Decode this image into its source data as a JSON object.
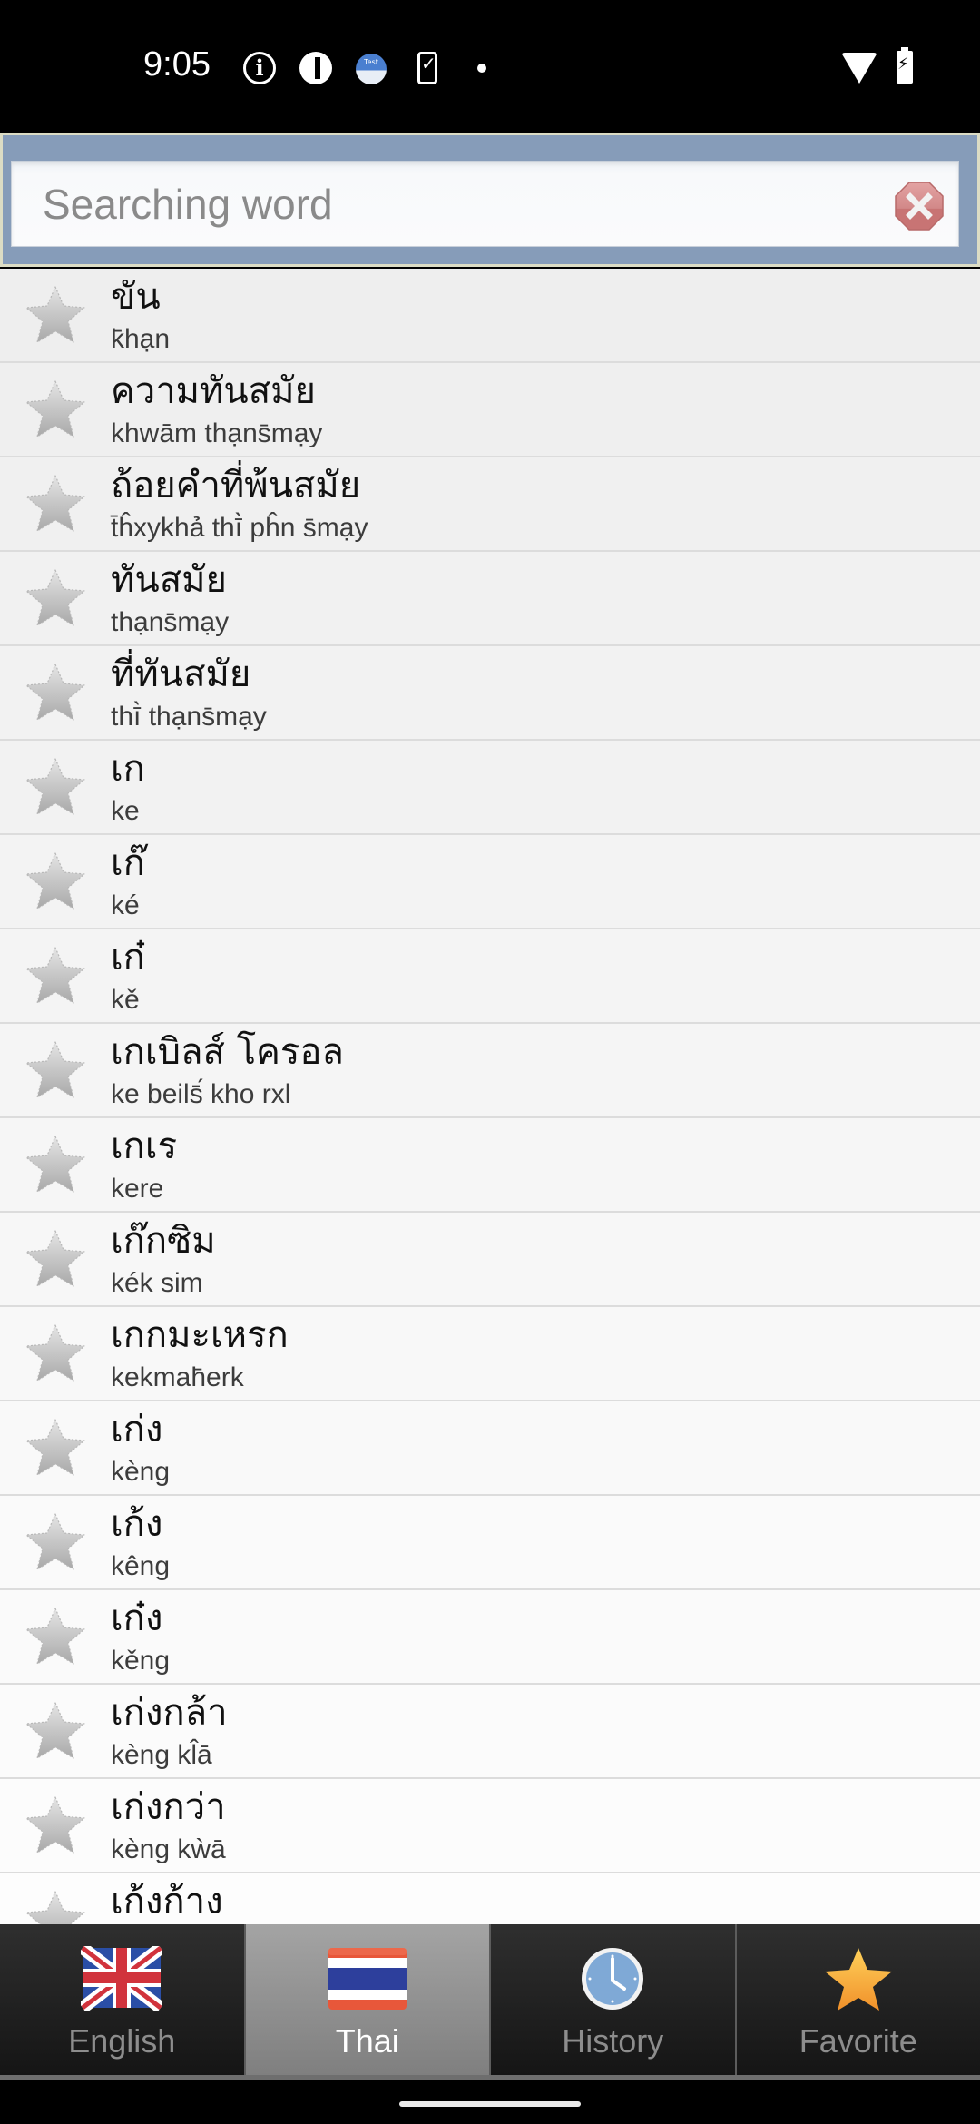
{
  "status_bar": {
    "time": "9:05",
    "icons": [
      "info-icon",
      "app-pill-icon",
      "test-app-icon",
      "phone-check-icon",
      "notification-dot-icon",
      "wifi-icon",
      "battery-charging-icon"
    ],
    "test_icon_label": "Test"
  },
  "search": {
    "placeholder": "Searching word",
    "value": "",
    "clear_icon": "clear-icon",
    "clear_color": "#c97878"
  },
  "words": [
    {
      "thai": "ขัน",
      "roman": "k̄hạn",
      "favorite": false
    },
    {
      "thai": "ความทันสมัย",
      "roman": "khwām thạns̄mạy",
      "favorite": false
    },
    {
      "thai": "ถ้อยคำที่พ้นสมัย",
      "roman": "t̄ĥxykhả thī̀ pĥn s̄mạy",
      "favorite": false
    },
    {
      "thai": "ทันสมัย",
      "roman": "thạns̄mạy",
      "favorite": false
    },
    {
      "thai": "ที่ทันสมัย",
      "roman": "thī̀ thạns̄mạy",
      "favorite": false
    },
    {
      "thai": "เก",
      "roman": "ke",
      "favorite": false
    },
    {
      "thai": "เก๊",
      "roman": "ké",
      "favorite": false
    },
    {
      "thai": "เก๋",
      "roman": "kě",
      "favorite": false
    },
    {
      "thai": "เกเบิลส์ โครอล",
      "roman": "ke beils̄́ kho rxl",
      "favorite": false
    },
    {
      "thai": "เกเร",
      "roman": "kere",
      "favorite": false
    },
    {
      "thai": "เก๊กซิม",
      "roman": "kék sim",
      "favorite": false
    },
    {
      "thai": "เกกมะเหรก",
      "roman": "kekmah̄erk",
      "favorite": false
    },
    {
      "thai": "เก่ง",
      "roman": "kèng",
      "favorite": false
    },
    {
      "thai": "เก้ง",
      "roman": "kêng",
      "favorite": false
    },
    {
      "thai": "เก๋ง",
      "roman": "kěng",
      "favorite": false
    },
    {
      "thai": "เก่งกล้า",
      "roman": "kèng kl̂ā",
      "favorite": false
    },
    {
      "thai": "เก่งกว่า",
      "roman": "kèng kẁā",
      "favorite": false
    },
    {
      "thai": "เก้งก้าง",
      "roman": "",
      "favorite": false
    }
  ],
  "tabs": [
    {
      "label": "English",
      "icon": "uk-flag-icon",
      "selected": false
    },
    {
      "label": "Thai",
      "icon": "thai-flag-icon",
      "selected": true
    },
    {
      "label": "History",
      "icon": "clock-icon",
      "selected": false
    },
    {
      "label": "Favorite",
      "icon": "star-icon",
      "selected": false
    }
  ],
  "colors": {
    "search_panel": "#869cb9",
    "list_bg": "#f3f3f3",
    "tab_selected": "#909090",
    "tab_unselected": "#1e1e1e",
    "favorite_star": "#f5a623"
  }
}
